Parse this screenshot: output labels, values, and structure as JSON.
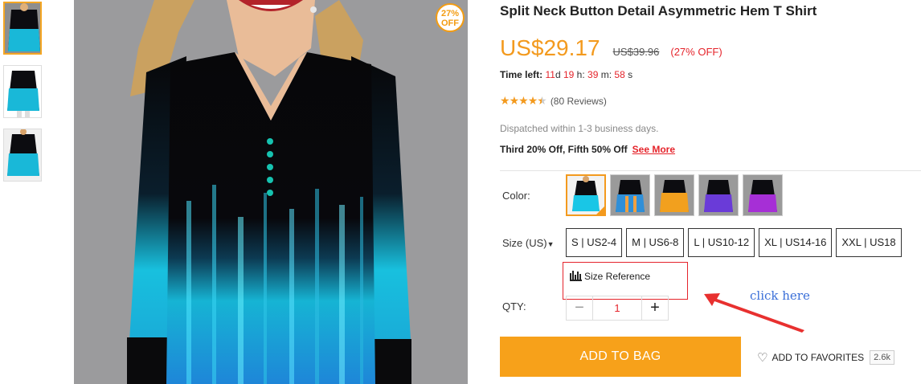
{
  "thumbnails": [
    {
      "name": "thumb-1",
      "active": true
    },
    {
      "name": "thumb-2",
      "active": false
    },
    {
      "name": "thumb-3",
      "active": false
    }
  ],
  "main_image": {
    "badge_percent": "27%",
    "badge_off": "OFF"
  },
  "product": {
    "title": "Split Neck Button Detail Asymmetric Hem T Shirt",
    "price": "US$29.17",
    "old_price": "US$39.96",
    "discount": "(27% OFF)",
    "time_left_label": "Time left:",
    "time_left": {
      "days": "11",
      "d": "d",
      "hours": "19",
      "h": "h:",
      "minutes": "39",
      "m": "m:",
      "seconds": "58",
      "s": "s"
    },
    "stars": "★★★★★",
    "rating": 4.5,
    "reviews": "(80 Reviews)",
    "dispatch": "Dispatched within 1-3 business days.",
    "promo_text": "Third 20% Off, Fifth 50% Off",
    "promo_link": "See More"
  },
  "options": {
    "color_label": "Color:",
    "colors": [
      {
        "name": "cyan",
        "hex": "#19c6e6",
        "selected": true
      },
      {
        "name": "blue-orange",
        "hex": "#2f8fd8",
        "selected": false
      },
      {
        "name": "orange",
        "hex": "#f2a01e",
        "selected": false
      },
      {
        "name": "purple",
        "hex": "#6a3bd8",
        "selected": false
      },
      {
        "name": "magenta",
        "hex": "#a62fd6",
        "selected": false
      }
    ],
    "size_label": "Size (US)",
    "sizes": [
      "S | US2-4",
      "M | US6-8",
      "L | US10-12",
      "XL | US14-16",
      "XXL | US18"
    ],
    "size_reference": "Size Reference",
    "qty_label": "QTY:",
    "qty_minus": "−",
    "qty_value": "1",
    "qty_plus": "+"
  },
  "actions": {
    "add_to_bag": "ADD TO BAG",
    "add_to_favorites": "ADD TO FAVORITES",
    "favorites_count": "2.6k"
  },
  "annotation": {
    "click_here": "click here"
  },
  "colors": {
    "accent": "#f7a11a",
    "discount_red": "#e5242b",
    "annotation_blue": "#3a6fd8"
  }
}
